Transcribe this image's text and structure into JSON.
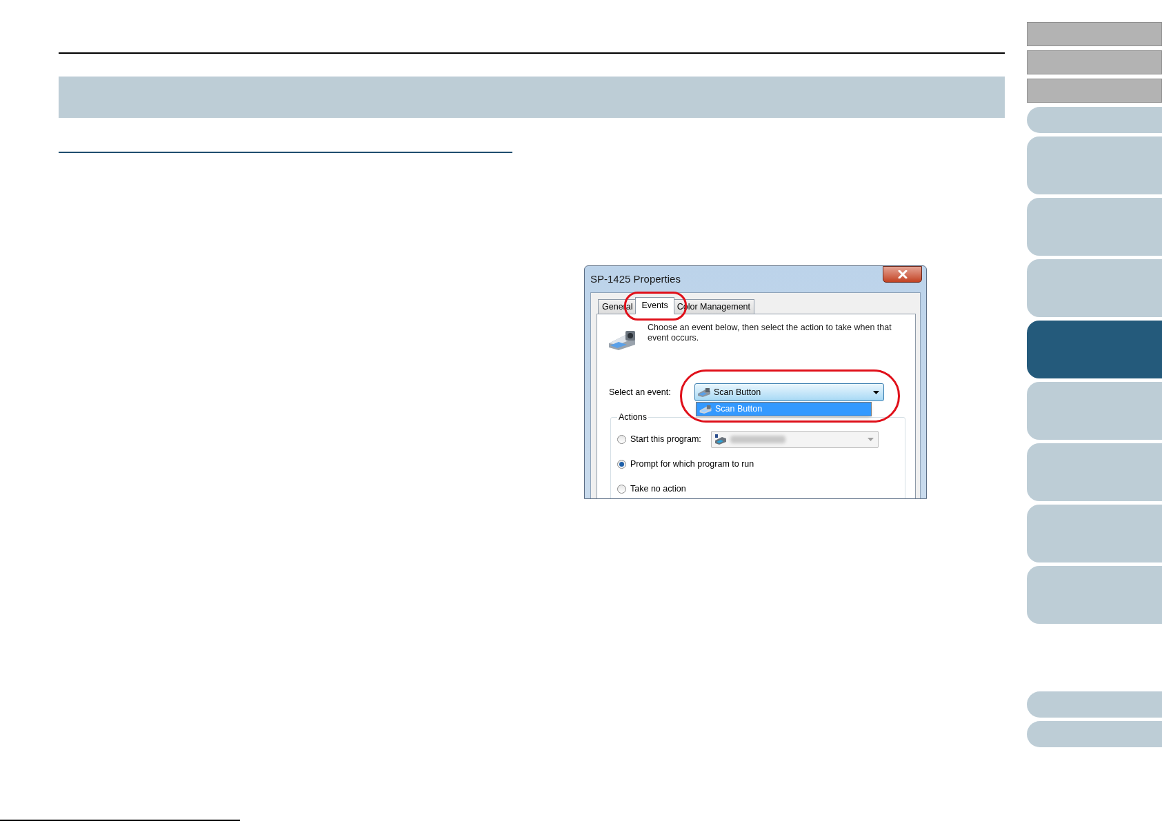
{
  "side_tabs": [
    {
      "kind": "plain"
    },
    {
      "kind": "plain"
    },
    {
      "kind": "plain"
    },
    {
      "kind": "small",
      "selected": false
    },
    {
      "kind": "large",
      "selected": false
    },
    {
      "kind": "large",
      "selected": false
    },
    {
      "kind": "large",
      "selected": false
    },
    {
      "kind": "large",
      "selected": true
    },
    {
      "kind": "large",
      "selected": false
    },
    {
      "kind": "large",
      "selected": false
    },
    {
      "kind": "large",
      "selected": false
    },
    {
      "kind": "large",
      "selected": false
    },
    {
      "kind": "bottom",
      "selected": false
    },
    {
      "kind": "small",
      "selected": false
    }
  ],
  "dialog": {
    "title": "SP-1425 Properties",
    "tabs": [
      {
        "label": "General",
        "selected": false
      },
      {
        "label": "Events",
        "selected": true
      },
      {
        "label": "Color Management",
        "selected": false
      }
    ],
    "description": "Choose an event below, then select the action to take when that event occurs.",
    "event_label": "Select an event:",
    "event_value": "Scan Button",
    "dropdown_items": [
      {
        "label": "Scan Button",
        "selected": true
      }
    ],
    "actions_label": "Actions",
    "actions": [
      {
        "kind": "program",
        "label": "Start this program:",
        "selected": false
      },
      {
        "kind": "plain",
        "label": "Prompt for which program to run",
        "selected": true
      },
      {
        "kind": "plain",
        "label": "Take no action",
        "selected": false
      }
    ]
  }
}
